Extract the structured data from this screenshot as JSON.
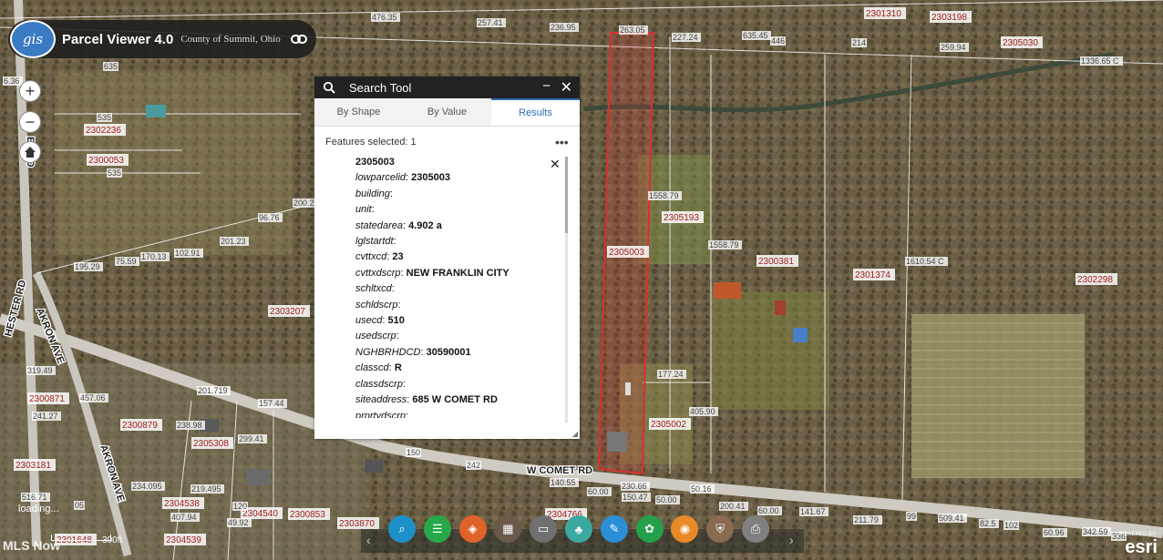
{
  "app": {
    "title": "Parcel Viewer 4.0",
    "org": "County of Summit, Ohio",
    "logo_text": "gis"
  },
  "map": {
    "parcel_ids": [
      "2301310",
      "2303198",
      "2305030",
      "2302236",
      "2300053",
      "2305193",
      "2305003",
      "2300381",
      "2301374",
      "2302298",
      "2303207",
      "2300871",
      "2300879",
      "2305308",
      "2305002",
      "2303181",
      "2304538",
      "2304540",
      "2300853",
      "2303870",
      "2304766",
      "2304539",
      "2301648"
    ],
    "dimensions": [
      "476.35",
      "257.41",
      "236.95",
      "263.05",
      "227.24",
      "635.45",
      "446",
      "214",
      "259.94",
      "1336.65 C",
      "635",
      "535",
      "535",
      "96.76",
      "200.2",
      "201.23",
      "102.91",
      "75.59",
      "170.13",
      "195.29",
      "1558.79",
      "1558.79",
      "1610.54 C",
      "177.24",
      "405.90",
      "201.719",
      "157.44",
      "241.27",
      "319.49",
      "234.095",
      "219.495",
      "407.94",
      "49.92",
      "120",
      "299.41",
      "150",
      "242",
      "140.55",
      "60.00",
      "230.66",
      "150.47",
      "50.00",
      "50.16",
      "200.41",
      "60.00",
      "141.67",
      "211.79",
      "99",
      "509.41",
      "82.5",
      "102",
      "60.96",
      "342.59",
      "336",
      "6.36",
      "457.06",
      "238.98",
      "516.71",
      "05"
    ],
    "roads": [
      "AKRON AVE",
      "HESTER RD",
      "AKRON AVE",
      "W COMET RD",
      "ES RD"
    ]
  },
  "search_tool": {
    "title": "Search Tool",
    "tabs": [
      "By Shape",
      "By Value",
      "Results"
    ],
    "active_tab": "Results",
    "features_selected_label": "Features selected: 1",
    "result_id": "2305003",
    "fields": [
      {
        "key": "lowparcelid",
        "value": "2305003"
      },
      {
        "key": "building",
        "value": ""
      },
      {
        "key": "unit",
        "value": ""
      },
      {
        "key": "statedarea",
        "value": "4.902 a"
      },
      {
        "key": "lglstartdt",
        "value": ""
      },
      {
        "key": "cvttxcd",
        "value": "23"
      },
      {
        "key": "cvttxdscrp",
        "value": "NEW FRANKLIN CITY"
      },
      {
        "key": "schltxcd",
        "value": ""
      },
      {
        "key": "schldscrp",
        "value": ""
      },
      {
        "key": "usecd",
        "value": "510"
      },
      {
        "key": "usedscrp",
        "value": ""
      },
      {
        "key": "NGHBRHDCD",
        "value": "30590001"
      },
      {
        "key": "classcd",
        "value": "R"
      },
      {
        "key": "classdscrp",
        "value": ""
      },
      {
        "key": "siteaddress",
        "value": "685 W COMET RD"
      },
      {
        "key": "prprtydscrp",
        "value": ""
      }
    ]
  },
  "controls": {
    "zoom_in": "+",
    "zoom_out": "−",
    "loading": "loading...",
    "scale_label": "300ft",
    "watermark": "MLS Now",
    "powered_by": "POWERED BY",
    "esri": "esri"
  },
  "toolbar": {
    "icons": [
      "search-icon",
      "list-icon",
      "layers-icon",
      "grid-icon",
      "chat-icon",
      "legend-icon",
      "measure-icon",
      "film-icon",
      "map-pin-icon",
      "bookmark-icon",
      "print-icon"
    ],
    "colors": [
      "#1e90c8",
      "#27a84a",
      "#e0622b",
      "#6b5a4a",
      "#707070",
      "#3ca9a0",
      "#2a8fd6",
      "#24a04a",
      "#e88a2a",
      "#8a6b50",
      "#808080"
    ]
  },
  "colors": {
    "selected_parcel": "#d93030",
    "parcel_line": "#f0f0f0",
    "panel_header": "#222222",
    "active_tab": "#2b6cb0"
  }
}
